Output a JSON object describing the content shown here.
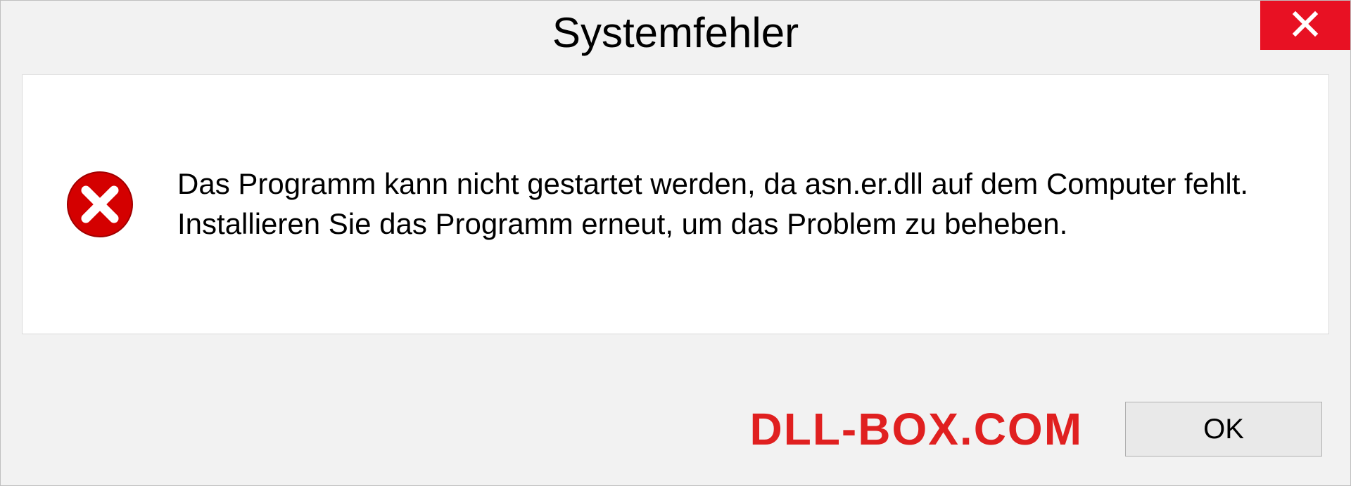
{
  "dialog": {
    "title": "Systemfehler",
    "message": "Das Programm kann nicht gestartet werden, da asn.er.dll auf dem Computer fehlt. Installieren Sie das Programm erneut, um das Problem zu beheben.",
    "ok_label": "OK"
  },
  "watermark": "DLL-BOX.COM",
  "colors": {
    "close_btn": "#e81123",
    "error_red": "#d40000",
    "watermark_red": "#e02020"
  }
}
